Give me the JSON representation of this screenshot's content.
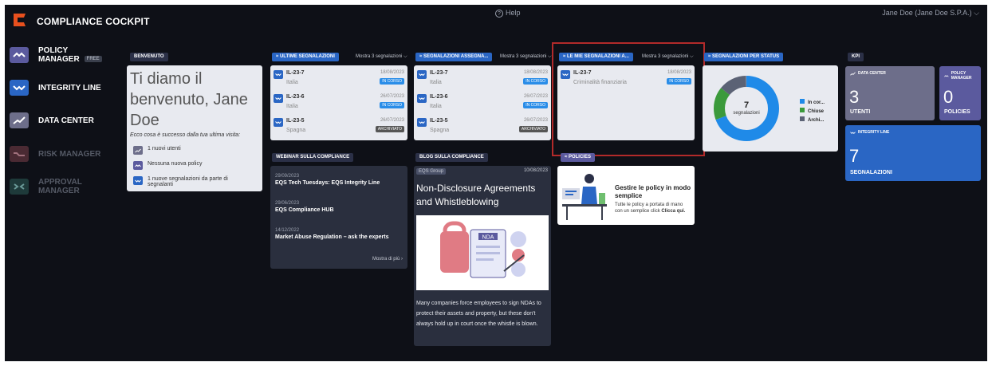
{
  "app": {
    "title": "COMPLIANCE COCKPIT",
    "help": "Help",
    "user": "Jane Doe (Jane Doe S.P.A.)"
  },
  "colors": {
    "accent": "#2a66c4",
    "policy": "#5b5a9e",
    "brand_orange": "#e8501e",
    "highlight": "#b22a2a"
  },
  "sidebar": [
    {
      "line1": "POLICY",
      "line2": "MANAGER",
      "badge": "FREE",
      "icon": "policy-manager-icon"
    },
    {
      "line1": "INTEGRITY LINE",
      "icon": "integrity-line-icon"
    },
    {
      "line1": "DATA CENTER",
      "icon": "data-center-icon"
    },
    {
      "line1": "RISK MANAGER",
      "icon": "risk-manager-icon"
    },
    {
      "line1": "APPROVAL",
      "line2": "MANAGER",
      "icon": "approval-manager-icon"
    }
  ],
  "welcome": {
    "tag": "BENVENUTO",
    "title": "Ti diamo il benvenuto, Jane Doe",
    "subtitle": "Ecco cosa è successo dalla tua ultima visita:",
    "items": [
      "1 nuovi utenti",
      "Nessuna nuova policy",
      "1 nuove segnalazioni da parte di segnalanti"
    ]
  },
  "ultime": {
    "tag": "ULTIME SEGNALAZIONI",
    "more": "Mostra 3 segnalazioni",
    "rows": [
      {
        "id": "IL-23-7",
        "place": "Italia",
        "date": "18/08/2023",
        "status": "IN CORSO"
      },
      {
        "id": "IL-23-6",
        "place": "Italia",
        "date": "26/07/2023",
        "status": "IN CORSO"
      },
      {
        "id": "IL-23-5",
        "place": "Spagna",
        "date": "26/07/2023",
        "status": "ARCHIVIATO"
      }
    ]
  },
  "assegnate": {
    "tag": "SEGNALAZIONI ASSEGNA...",
    "more": "Mostra 3 segnalazioni",
    "rows": [
      {
        "id": "IL-23-7",
        "place": "Italia",
        "date": "18/08/2023",
        "status": "IN CORSO"
      },
      {
        "id": "IL-23-6",
        "place": "Italia",
        "date": "26/07/2023",
        "status": "IN CORSO"
      },
      {
        "id": "IL-23-5",
        "place": "Spagna",
        "date": "26/07/2023",
        "status": "ARCHIVIATO"
      }
    ]
  },
  "mie": {
    "tag": "LE MIE SEGNALAZIONI A...",
    "more": "Mostra 3 segnalazioni",
    "rows": [
      {
        "id": "IL-23-7",
        "place": "Criminalità finanziaria",
        "date": "18/08/2023",
        "status": "IN CORSO"
      }
    ]
  },
  "status": {
    "tag": "SEGNALAZIONI PER STATUS",
    "center_num": "7",
    "center_lbl": "segnalazioni",
    "legend": [
      "In cor...",
      "Chiuse",
      "Archi..."
    ]
  },
  "kpi": {
    "tag": "KPI",
    "cards": [
      {
        "title": "DATA CENTER",
        "num": "3",
        "label": "UTENTI"
      },
      {
        "title": "POLICY MANAGER",
        "num": "0",
        "label": "POLICIES"
      },
      {
        "title": "INTEGRITY LINE",
        "num": "7",
        "label": "SEGNALAZIONI"
      }
    ]
  },
  "webinar": {
    "tag": "WEBINAR SULLA COMPLIANCE",
    "items": [
      {
        "date": "29/09/2023",
        "title": "EQS Tech Tuesdays: EQS Integrity Line"
      },
      {
        "date": "29/06/2023",
        "title": "EQS Compliance HUB"
      },
      {
        "date": "14/12/2022",
        "title": "Market Abuse Regulation – ask the experts"
      }
    ],
    "more": "Mostra di più"
  },
  "blog": {
    "tag": "BLOG SULLA COMPLIANCE",
    "source": "EQS Group",
    "date": "10/08/2023",
    "title": "Non-Disclosure Agreements and Whistleblowing",
    "image_text": "NDA",
    "body": "Many companies force employees to sign NDAs to protect their assets and property, but these don't always hold up in court once the whistle is blown."
  },
  "policies": {
    "tag": "POLICIES",
    "title": "Gestire le policy in modo semplice",
    "body": "Tutte le policy a portata di mano con un semplice click",
    "link": "Clicca qui."
  }
}
